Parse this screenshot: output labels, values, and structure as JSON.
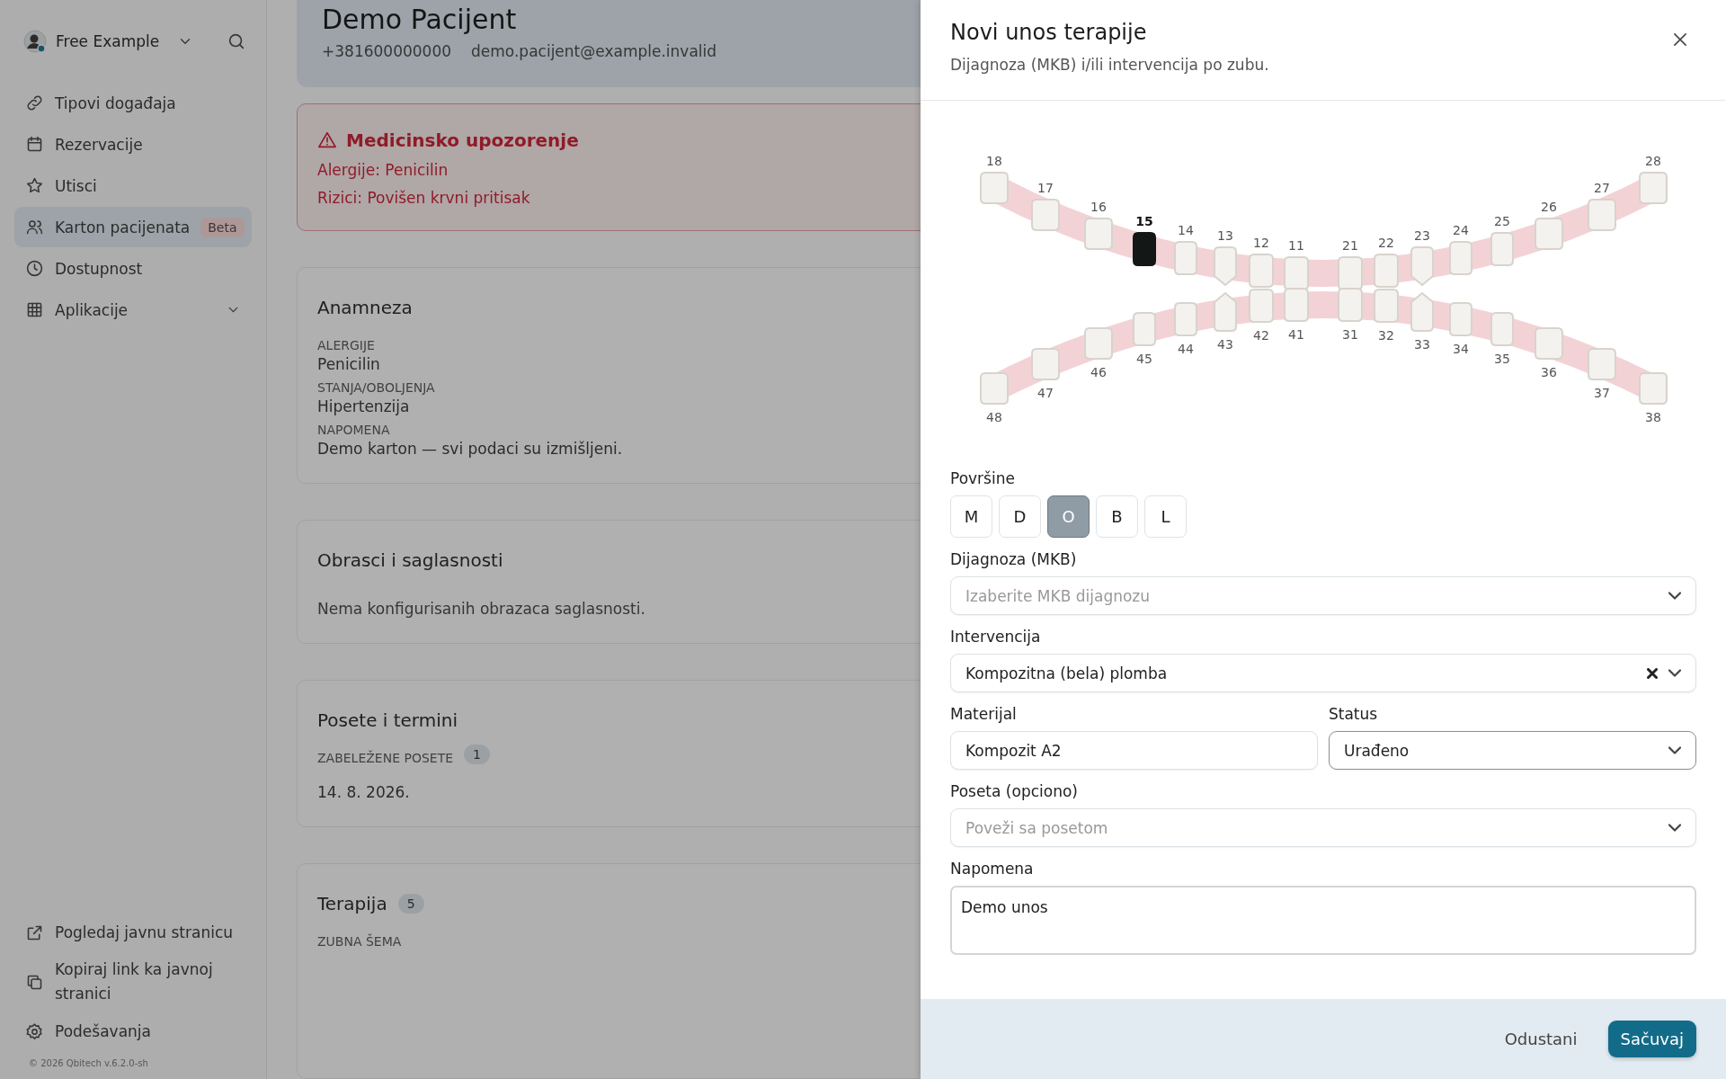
{
  "sidebar": {
    "account": {
      "name": "Free Example"
    },
    "items": [
      {
        "label": "Tipovi događaja",
        "selected": false
      },
      {
        "label": "Rezervacije",
        "selected": false
      },
      {
        "label": "Utisci",
        "selected": false
      },
      {
        "label": "Karton pacijenata",
        "selected": true,
        "badge": "Beta"
      },
      {
        "label": "Dostupnost",
        "selected": false
      },
      {
        "label": "Aplikacije",
        "selected": false,
        "expanded": false
      }
    ],
    "footer_items": [
      {
        "label": "Pogledaj javnu stranicu"
      },
      {
        "label": "Kopiraj link ka javnoj stranici"
      },
      {
        "label": "Podešavanja"
      }
    ],
    "copyright": "© 2026 Qbitech v.6.2.0-sh"
  },
  "patient": {
    "name": "Demo Pacijent",
    "phone": "+381600000000",
    "email": "demo.pacijent@example.invalid"
  },
  "alert": {
    "title": "Medicinsko upozorenje",
    "lines": [
      "Alergije: Penicilin",
      "Rizici: Povišen krvni pritisak"
    ]
  },
  "sections": [
    {
      "kind": "fields",
      "title": "Anamneza",
      "fields": [
        {
          "label": "ALERGIJE",
          "value": "Penicilin"
        },
        {
          "label": "STANJA/OBOLJENJA",
          "value": "Hipertenzija"
        },
        {
          "label": "NAPOMENA",
          "value": "Demo karton — svi podaci su izmišljeni."
        }
      ]
    },
    {
      "kind": "text",
      "title": "Obrasci i saglasnosti",
      "text": "Nema konfigurisanih obrazaca saglasnosti."
    },
    {
      "kind": "visits",
      "title": "Posete i termini",
      "label": "ZABELEŽENE POSETE",
      "count": "1",
      "dates": [
        "14. 8. 2026."
      ]
    },
    {
      "kind": "therapy",
      "title": "Terapija",
      "count": "5",
      "label": "ZUBNA ŠEMA"
    }
  ],
  "drawer": {
    "title": "Novi unos terapije",
    "subtitle": "Dijagnoza (MKB) i/ili intervencija po zubu.",
    "teeth": {
      "upper": [
        {
          "number": "18",
          "selected": false
        },
        {
          "number": "17",
          "selected": false
        },
        {
          "number": "16",
          "selected": false
        },
        {
          "number": "15",
          "selected": true
        },
        {
          "number": "14",
          "selected": false
        },
        {
          "number": "13",
          "selected": false
        },
        {
          "number": "12",
          "selected": false
        },
        {
          "number": "11",
          "selected": false
        },
        {
          "number": "21",
          "selected": false
        },
        {
          "number": "22",
          "selected": false
        },
        {
          "number": "23",
          "selected": false
        },
        {
          "number": "24",
          "selected": false
        },
        {
          "number": "25",
          "selected": false
        },
        {
          "number": "26",
          "selected": false
        },
        {
          "number": "27",
          "selected": false
        },
        {
          "number": "28",
          "selected": false
        }
      ],
      "lower": [
        {
          "number": "48",
          "selected": false
        },
        {
          "number": "47",
          "selected": false
        },
        {
          "number": "46",
          "selected": false
        },
        {
          "number": "45",
          "selected": false
        },
        {
          "number": "44",
          "selected": false
        },
        {
          "number": "43",
          "selected": false
        },
        {
          "number": "42",
          "selected": false
        },
        {
          "number": "41",
          "selected": false
        },
        {
          "number": "31",
          "selected": false
        },
        {
          "number": "32",
          "selected": false
        },
        {
          "number": "33",
          "selected": false
        },
        {
          "number": "34",
          "selected": false
        },
        {
          "number": "35",
          "selected": false
        },
        {
          "number": "36",
          "selected": false
        },
        {
          "number": "37",
          "selected": false
        },
        {
          "number": "38",
          "selected": false
        }
      ]
    },
    "surfaces": {
      "label": "Površine",
      "options": [
        {
          "label": "M",
          "selected": false
        },
        {
          "label": "D",
          "selected": false
        },
        {
          "label": "O",
          "selected": true
        },
        {
          "label": "B",
          "selected": false
        },
        {
          "label": "L",
          "selected": false
        }
      ]
    },
    "rows": [
      {
        "fields": [
          {
            "kind": "select",
            "label": "Dijagnoza (MKB)",
            "placeholder": "Izaberite MKB dijagnozu"
          }
        ]
      },
      {
        "fields": [
          {
            "kind": "select",
            "label": "Intervencija",
            "value": "Kompozitna (bela) plomba",
            "clearable": true
          }
        ]
      },
      {
        "fields": [
          {
            "kind": "input",
            "label": "Materijal",
            "value": "Kompozit A2"
          },
          {
            "kind": "select",
            "label": "Status",
            "value": "Urađeno",
            "focused": true
          }
        ]
      },
      {
        "fields": [
          {
            "kind": "select",
            "label": "Poseta (opciono)",
            "placeholder": "Poveži sa posetom"
          }
        ]
      },
      {
        "fields": [
          {
            "kind": "textarea",
            "label": "Napomena",
            "value": "Demo unos"
          }
        ]
      }
    ],
    "buttons": [
      {
        "label": "Odustani",
        "kind": "secondary"
      },
      {
        "label": "Sačuvaj",
        "kind": "primary"
      }
    ]
  }
}
